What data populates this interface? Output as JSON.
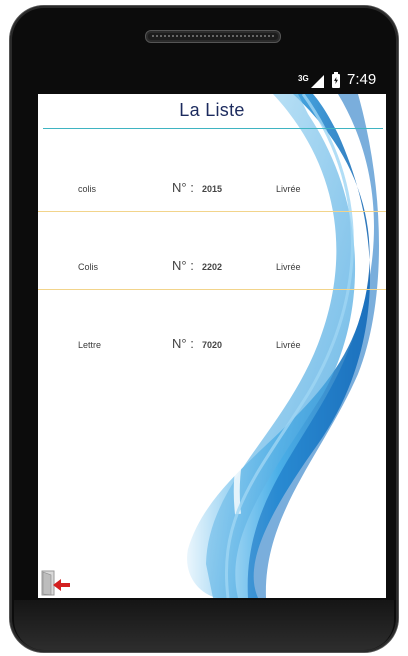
{
  "status_bar": {
    "network": "3G",
    "time": "7:49"
  },
  "screen": {
    "title": "La Liste",
    "items": [
      {
        "type": "colis",
        "number_label": "N° :",
        "number": "2015",
        "status": "Livrée"
      },
      {
        "type": "Colis",
        "number_label": "N° :",
        "number": "2202",
        "status": "Livrée"
      },
      {
        "type": "Lettre",
        "number_label": "N° :",
        "number": "7020",
        "status": "Livrée"
      }
    ]
  },
  "colors": {
    "title_line": "#3fb4c2",
    "divider": "#f2d48b",
    "wave": "#1a8fd8",
    "title_text": "#1c2b5e"
  },
  "icons": {
    "exit": "exit-door-icon",
    "signal": "signal-icon",
    "battery": "battery-charging-icon"
  }
}
